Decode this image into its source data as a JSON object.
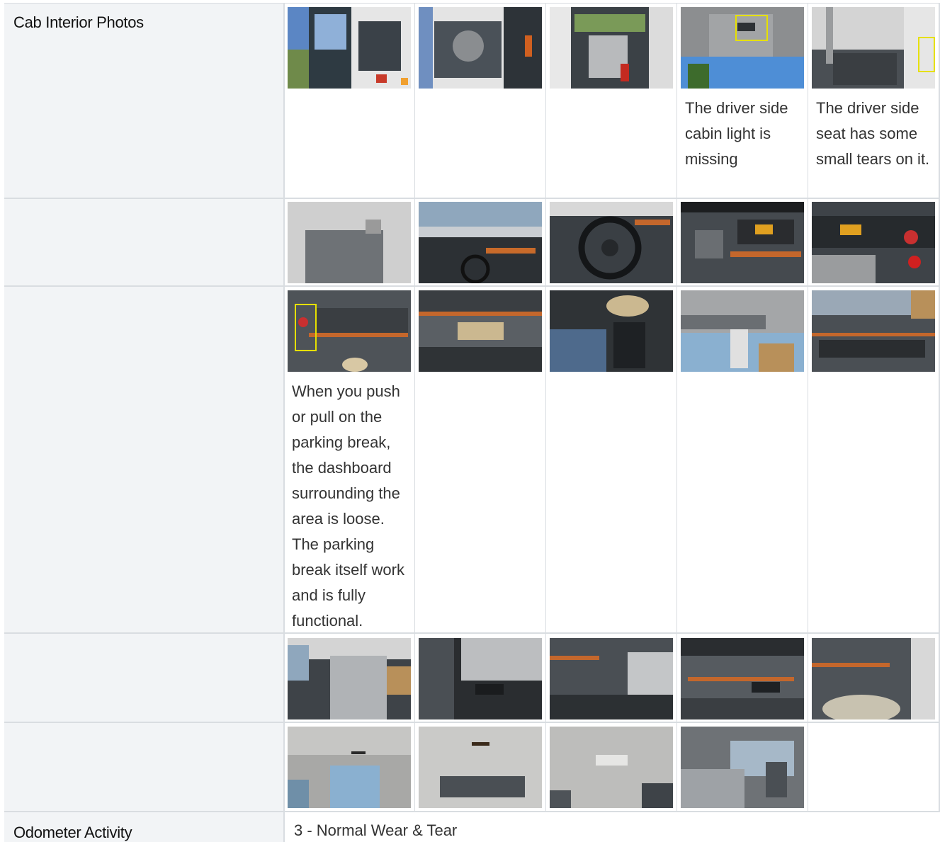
{
  "sections": [
    {
      "label": "Cab Interior Photos",
      "rows": [
        {
          "photos": [
            {
              "icon": "truck-door-open-photo",
              "note": ""
            },
            {
              "icon": "door-panel-photo",
              "note": ""
            },
            {
              "icon": "driver-seat-photo",
              "note": ""
            },
            {
              "icon": "cabin-ceiling-photo",
              "note": "The driver side cabin light is missing"
            },
            {
              "icon": "seat-floor-photo",
              "note": "The driver side seat has some small tears on it."
            }
          ]
        },
        {
          "photos": [
            {
              "icon": "floor-mat-photo",
              "note": ""
            },
            {
              "icon": "windshield-dash-photo",
              "note": ""
            },
            {
              "icon": "steering-wheel-photo",
              "note": ""
            },
            {
              "icon": "instrument-cluster-photo",
              "note": ""
            },
            {
              "icon": "gauges-photo",
              "note": ""
            }
          ]
        },
        {
          "photos": [
            {
              "icon": "parking-brake-photo",
              "note": "When you push or pull on the parking break, the dashboard surrounding the area is loose. The parking break itself work and is fully functional."
            },
            {
              "icon": "console-cupholder-photo",
              "note": ""
            },
            {
              "icon": "shifter-photo",
              "note": ""
            },
            {
              "icon": "overhead-mirror-photo",
              "note": ""
            },
            {
              "icon": "dashboard-switches-photo",
              "note": ""
            }
          ]
        },
        {
          "photos": [
            {
              "icon": "passenger-seat-photo",
              "note": ""
            },
            {
              "icon": "seat-controls-photo",
              "note": ""
            },
            {
              "icon": "dash-lower-photo",
              "note": ""
            },
            {
              "icon": "passenger-dash-photo",
              "note": ""
            },
            {
              "icon": "passenger-floor-photo",
              "note": ""
            }
          ]
        },
        {
          "photos": [
            {
              "icon": "rear-cab-photo",
              "note": ""
            },
            {
              "icon": "sleeper-ceiling-photo",
              "note": ""
            },
            {
              "icon": "dome-light-photo",
              "note": ""
            },
            {
              "icon": "rear-window-photo",
              "note": ""
            }
          ]
        }
      ]
    }
  ],
  "odometer": {
    "label": "Odometer Activity",
    "value": "3 - Normal Wear & Tear"
  },
  "colors": {
    "label_bg": "#f2f4f6",
    "grid": "#d9dde1",
    "highlight": "#e6e000"
  }
}
